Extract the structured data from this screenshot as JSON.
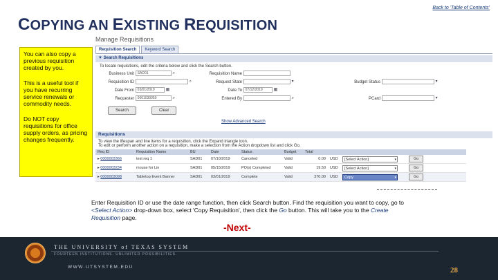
{
  "header": {
    "toc_link": "Back to 'Table of Contents'",
    "title_c1": "C",
    "title_r1": "OPYING AN ",
    "title_c2": "E",
    "title_r2": "XISTING ",
    "title_c3": "R",
    "title_r3": "EQUISITION"
  },
  "callout": {
    "p1": "You can also copy a previous requisition created by you.",
    "p2": "This is a useful tool if you have recurring service renewals or commodity needs.",
    "p3": "Do NOT copy requisitions for office supply orders, as pricing changes frequently."
  },
  "app": {
    "page_title": "Manage Requisitions",
    "tabs": [
      "Requisition Search",
      "Keyword Search"
    ],
    "search_section": "Search Requisitions",
    "search_instructions": "To locate requisitions, edit the criteria below and click the Search button.",
    "fields": {
      "business_unit_label": "Business Unit",
      "business_unit_value": "SAD01",
      "requisition_name_label": "Requisition Name",
      "requisition_id_label": "Requisition ID",
      "request_state_label": "Request State",
      "budget_status_label": "Budget Status",
      "date_from_label": "Date From",
      "date_from_value": "03/01/2019",
      "date_to_label": "Date To",
      "date_to_value": "07/12/2019",
      "requester_label": "Requester",
      "requester_value": "0001030050",
      "entered_by_label": "Entered By",
      "pcard_label": "PCard"
    },
    "search_button": "Search",
    "clear_button": "Clear",
    "advanced_link": "Show Advanced Search",
    "results_section": "Requisitions",
    "results_instructions_1": "To view the lifespan and line items for a requisition, click the Expand triangle icon.",
    "results_instructions_2": "To edit or perform another action on a requisition, make a selection from the Action dropdown list and click Go.",
    "columns": [
      "Req ID",
      "Requisition Name",
      "BU",
      "Date",
      "Status",
      "Budget",
      "Total",
      "",
      "",
      ""
    ],
    "rows": [
      {
        "req_id": "0000003366",
        "name": "test req 1",
        "bu": "SAD01",
        "date": "07/10/2019",
        "status": "Canceled",
        "budget": "Valid",
        "total": "0.00",
        "currency": "USD",
        "action": "[Select Action]",
        "go": "Go"
      },
      {
        "req_id": "0000003234",
        "name": "mouse for Lin",
        "bu": "SAD01",
        "date": "05/15/2019",
        "status": "PO(s) Completed",
        "budget": "Valid",
        "total": "19.50",
        "currency": "USD",
        "action": "[Select Action]",
        "go": "Go"
      },
      {
        "req_id": "0000003098",
        "name": "Tabletop Event Banner",
        "bu": "SAD01",
        "date": "03/01/2019",
        "status": "Complete",
        "budget": "Valid",
        "total": "370.00",
        "currency": "USD",
        "action": "Copy",
        "go": "Go"
      }
    ]
  },
  "caption": {
    "part1": "Enter Requisition ID or use the date range function, then click Search button. Find the requisition you want to copy, go to ",
    "select_action": "<Select Action>",
    "part2": " drop-down box, select 'Copy Requisition', then click the ",
    "go": "Go",
    "part3": " button. This will take you to the ",
    "create_req": "Create Requisition",
    "part4": " page."
  },
  "next_label": "-Next-",
  "footer": {
    "university": "THE UNIVERSITY of TEXAS SYSTEM",
    "tagline": "FOURTEEN INSTITUTIONS. UNLIMITED POSSIBILITIES.",
    "url": "WWW.UTSYSTEM.EDU",
    "page_number": "28"
  },
  "colors": {
    "title": "#1f2e5c",
    "callout_bg": "#ffff00",
    "next": "#c00000",
    "footer_bg": "#1c2630",
    "page_number": "#e0a64b"
  }
}
